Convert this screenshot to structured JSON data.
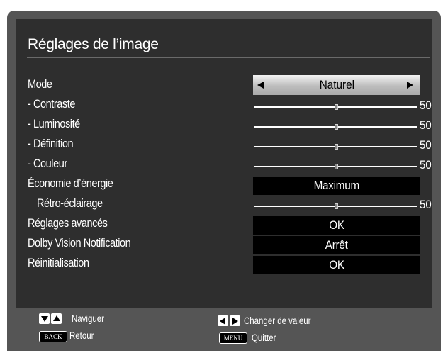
{
  "header": {
    "title": "Réglages de l’image"
  },
  "rows": {
    "mode": {
      "label": "Mode",
      "value": "Naturel"
    },
    "contrast": {
      "label": "- Contraste",
      "value": "50",
      "level": 0.5
    },
    "brightness": {
      "label": "- Luminosité",
      "value": "50",
      "level": 0.5
    },
    "sharpness": {
      "label": "- Définition",
      "value": "50",
      "level": 0.5
    },
    "color": {
      "label": "- Couleur",
      "value": "50",
      "level": 0.5
    },
    "energy_saving": {
      "label": "Économie d’énergie",
      "value": "Maximum"
    },
    "backlight": {
      "label": "Rétro-éclairage",
      "value": "50",
      "level": 0.5
    },
    "advanced": {
      "label": "Réglages avancés",
      "value": "OK"
    },
    "dolby": {
      "label": "Dolby Vision Notification",
      "value": "Arrêt"
    },
    "reset": {
      "label": "Réinitialisation",
      "value": "OK"
    }
  },
  "footer": {
    "navigate": "Naviguer",
    "change_value": "Changer de valeur",
    "back_key": "BACK",
    "back": "Retour",
    "menu_key": "MENU",
    "quit": "Quitter"
  },
  "icons": [
    "arrow-left-icon",
    "arrow-right-icon",
    "arrow-down-icon",
    "arrow-up-icon"
  ],
  "colors": {
    "panel": "#555555",
    "content": "#2e2e2e",
    "value_box": "#000000",
    "text": "#ffffff"
  }
}
